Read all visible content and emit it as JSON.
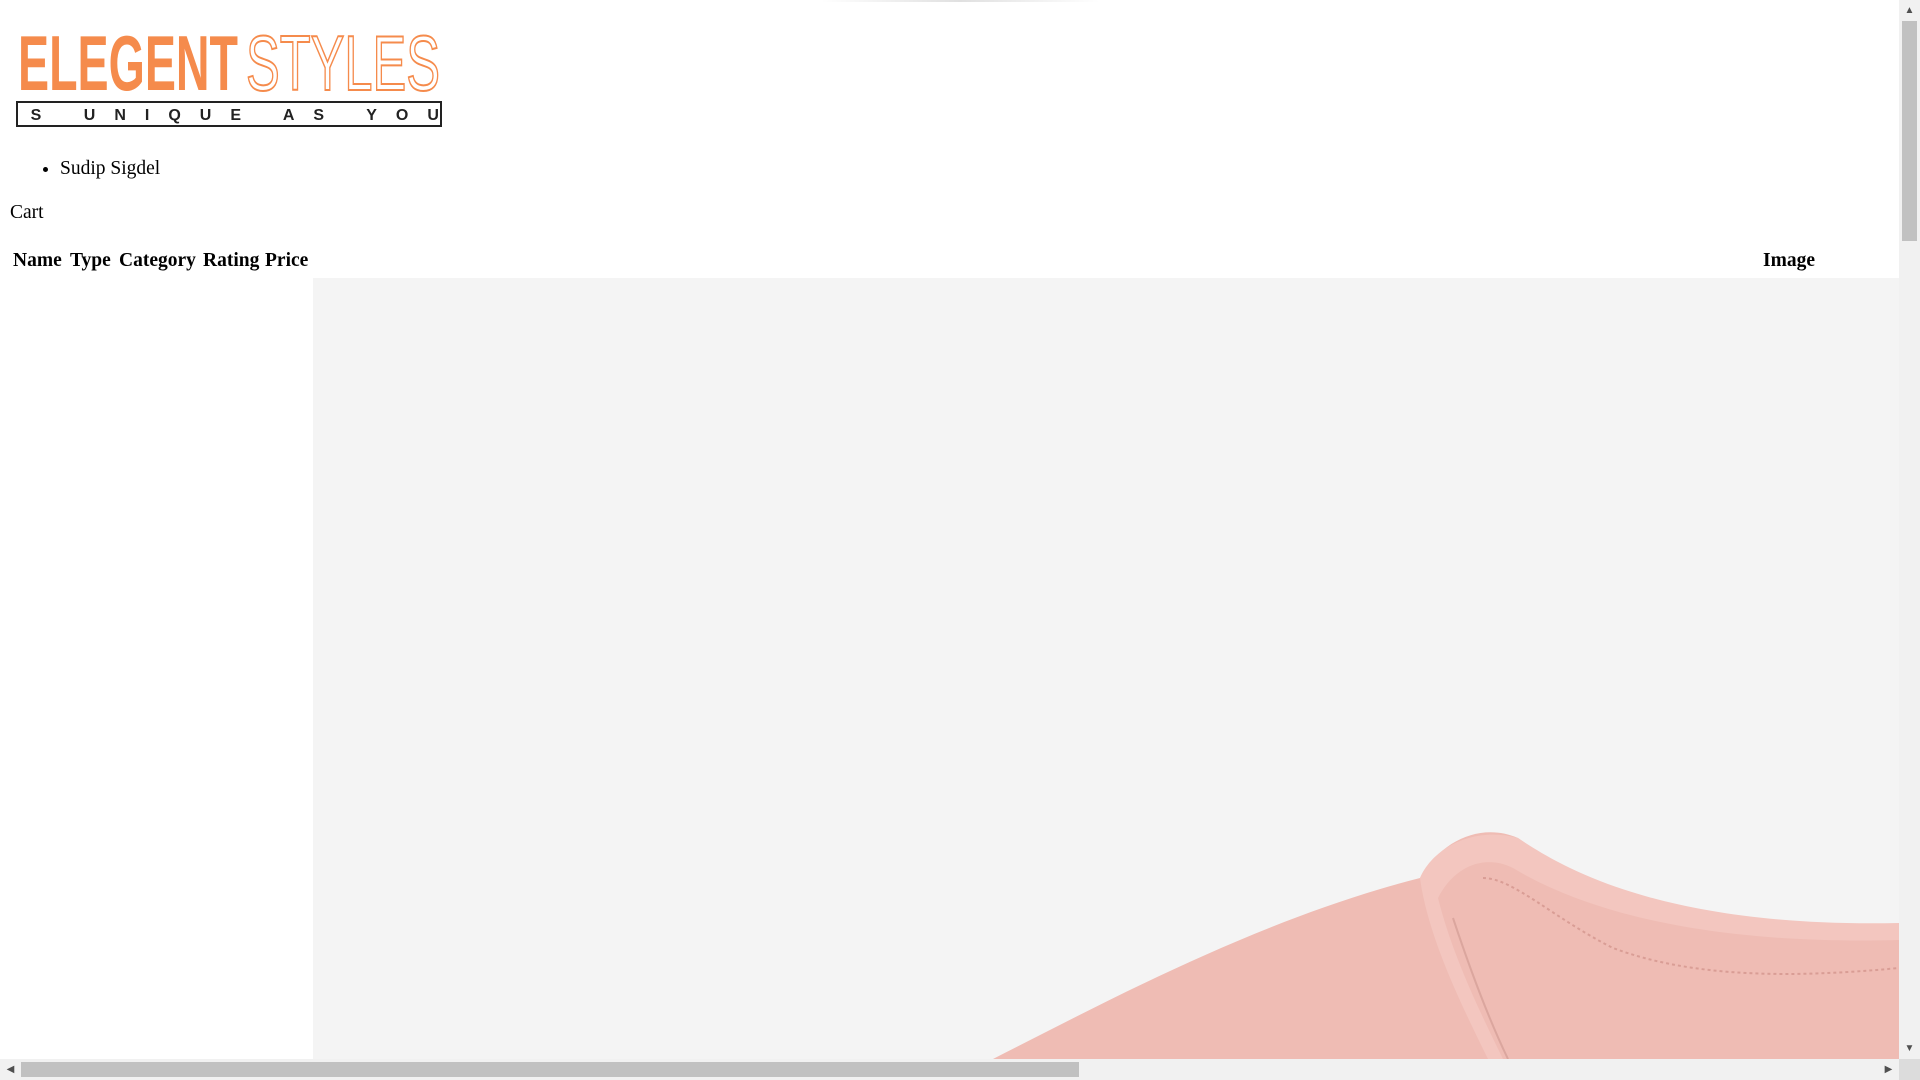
{
  "brand": {
    "name_part1": "ELEGENT",
    "name_part2": "STYLES",
    "tagline": "AS UNIQUE AS YOU",
    "accent_color": "#f58b4c"
  },
  "nav": {
    "user_name": "Sudip Sigdel",
    "cart_label": "Cart"
  },
  "table": {
    "headers": [
      "Name",
      "Type",
      "Category",
      "Rating",
      "Price",
      "Image"
    ]
  },
  "product_image": {
    "icon": "pink-tshirt-image",
    "shirt_color": "#efbcb4"
  },
  "scrollbars": {
    "up_arrow": "▲",
    "down_arrow": "▼",
    "left_arrow": "◀",
    "right_arrow": "▶"
  }
}
